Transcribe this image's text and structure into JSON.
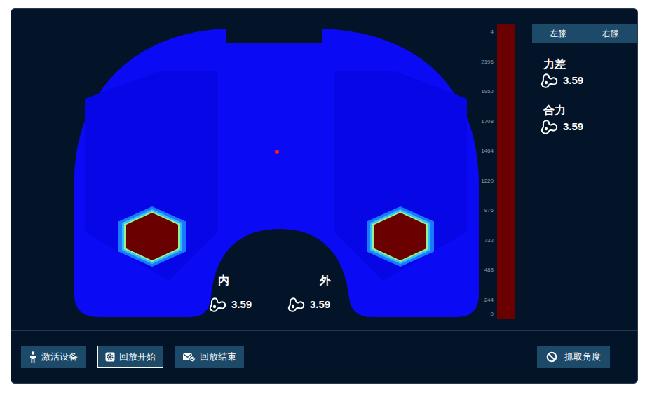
{
  "knee_map": {
    "labels": [
      {
        "text": "内",
        "value": "3.59"
      },
      {
        "text": "外",
        "value": "3.59"
      }
    ],
    "pads": [
      {
        "color": "#6b0000"
      },
      {
        "color": "#6b0000"
      }
    ]
  },
  "color_scale": {
    "ticks": [
      "4",
      "2196",
      "1952",
      "1708",
      "1464",
      "1220",
      "976",
      "732",
      "488",
      "244",
      "0"
    ]
  },
  "tabs": [
    {
      "label": "左膝",
      "selected": false
    },
    {
      "label": "右膝",
      "selected": false
    }
  ],
  "metrics": [
    {
      "label": "力差",
      "value": "3.59"
    },
    {
      "label": "合力",
      "value": "3.59"
    }
  ],
  "toolbar": {
    "left": [
      {
        "label": "激活设备",
        "focused": false
      },
      {
        "label": "回放开始",
        "focused": true
      },
      {
        "label": "回放结束",
        "focused": false
      }
    ],
    "right": [
      {
        "label": "抓取角度",
        "focused": false
      }
    ]
  }
}
